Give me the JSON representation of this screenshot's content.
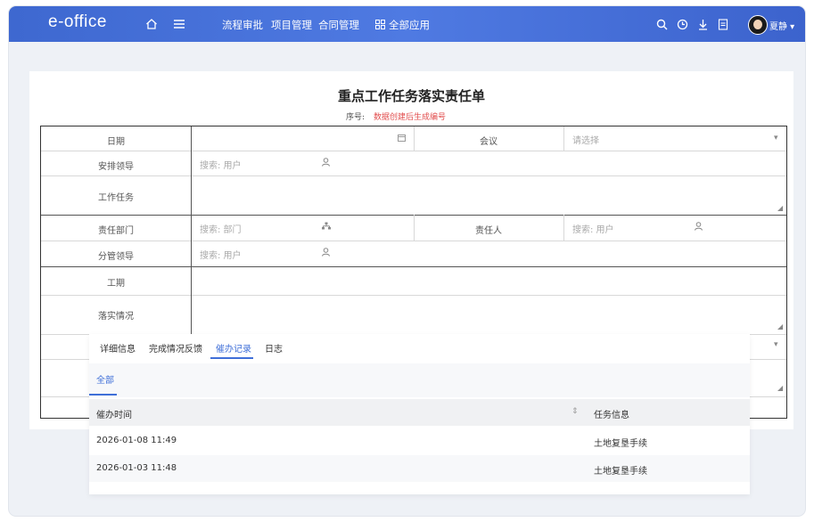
{
  "app": {
    "logo": "e-office"
  },
  "nav": [
    "流程审批",
    "项目管理",
    "合同管理"
  ],
  "all_apps": "全部应用",
  "user": {
    "name": "夏静"
  },
  "form": {
    "title": "重点工作任务落实责任单",
    "serial_label": "序号:",
    "serial_value": "数据创建后生成编号",
    "date_label": "日期",
    "meeting_label": "会议",
    "meeting_placeholder": "请选择",
    "leader_label": "安排领导",
    "user_search": "搜索: 用户",
    "task_label": "工作任务",
    "dept_label": "责任部门",
    "dept_search": "搜索: 部门",
    "person_label": "责任人",
    "charge_label": "分管领导",
    "period_label": "工期",
    "progress_label": "落实情况"
  },
  "panel": {
    "tabs": [
      "详细信息",
      "完成情况反馈",
      "催办记录",
      "日志"
    ],
    "active_tab": "催办记录",
    "subtab": "全部",
    "columns": {
      "time": "催办时间",
      "info": "任务信息"
    },
    "rows": [
      {
        "time": "2026-01-08 11:49",
        "info": "土地复垦手续"
      },
      {
        "time": "2026-01-03 11:48",
        "info": "土地复垦手续"
      }
    ]
  },
  "colors": {
    "accent": "#3f6fd8",
    "header": "#4a72db",
    "serial": "#e24d4d"
  },
  "icons": [
    "home-icon",
    "menu-icon",
    "grid-icon",
    "search-icon",
    "clock-icon",
    "download-icon",
    "document-icon",
    "calendar-icon",
    "user-icon",
    "org-icon",
    "sort-icon",
    "chevron-down-icon",
    "resize-handle-icon"
  ]
}
